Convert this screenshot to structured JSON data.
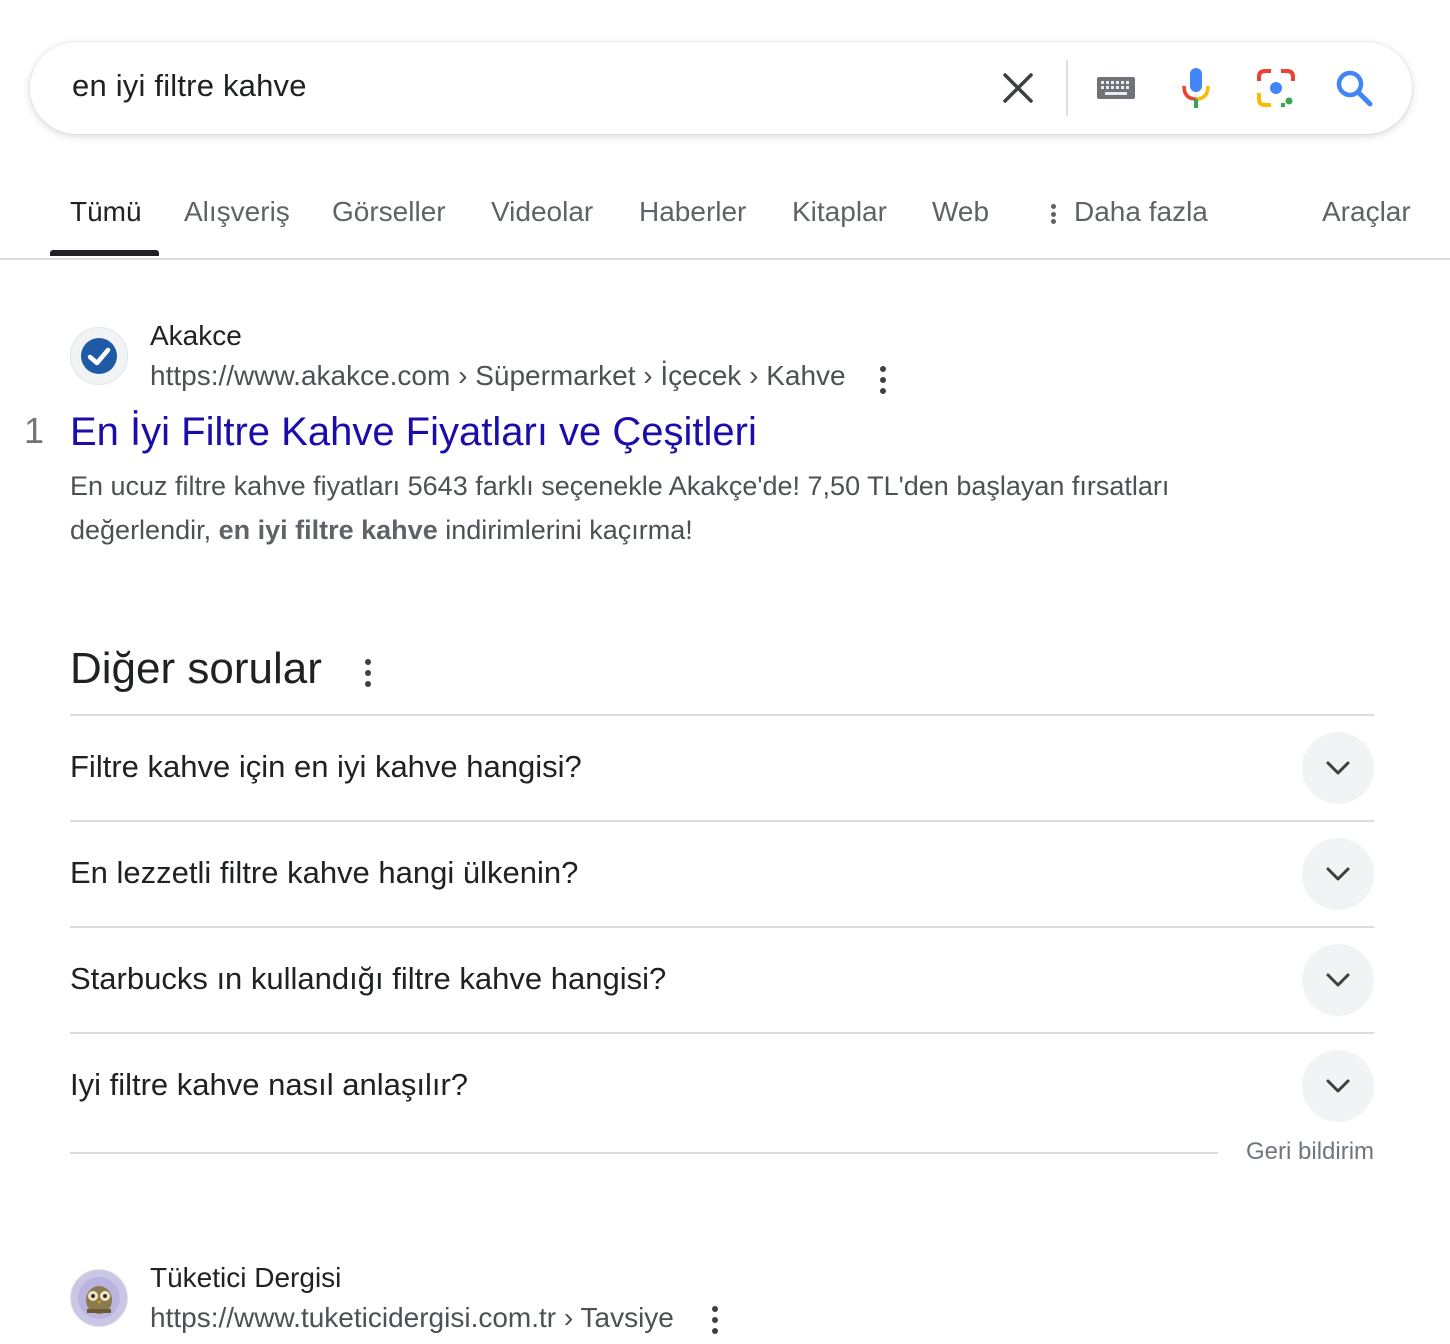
{
  "search": {
    "query": "en iyi filtre kahve",
    "icons": [
      "close-icon",
      "keyboard-icon",
      "microphone-icon",
      "google-lens-icon",
      "search-icon"
    ]
  },
  "tabs": [
    {
      "label": "Tümü",
      "active": true
    },
    {
      "label": "Alışveriş"
    },
    {
      "label": "Görseller"
    },
    {
      "label": "Videolar"
    },
    {
      "label": "Haberler"
    },
    {
      "label": "Kitaplar"
    },
    {
      "label": "Web"
    },
    {
      "label": "Daha fazla"
    },
    {
      "label": "Araçlar"
    }
  ],
  "results": [
    {
      "rank": "1",
      "site": "Akakce",
      "url": "https://www.akakce.com › Süpermarket › İçecek › Kahve",
      "title": "En İyi Filtre Kahve Fiyatları ve Çeşitleri",
      "snippet_pre": "En ucuz filtre kahve fiyatları 5643 farklı seçenekle Akakçe'de! 7,50 TL'den başlayan fırsatları değerlendir, ",
      "snippet_bold": "en iyi filtre kahve",
      "snippet_post": " indirimlerini kaçırma!"
    },
    {
      "site": "Tüketici Dergisi",
      "url": "https://www.tuketicidergisi.com.tr › Tavsiye"
    }
  ],
  "paa": {
    "title": "Diğer sorular",
    "questions": [
      "Filtre kahve için en iyi kahve hangisi?",
      "En lezzetli filtre kahve hangi ülkenin?",
      "Starbucks ın kullandığı filtre kahve hangisi?",
      "Iyi filtre kahve nasıl anlaşılır?"
    ],
    "feedback": "Geri bildirim"
  },
  "colors": {
    "link": "#1a0dab",
    "url_text": "#4d5156",
    "search_blue": "#4285f4",
    "divider": "#dadce0"
  }
}
